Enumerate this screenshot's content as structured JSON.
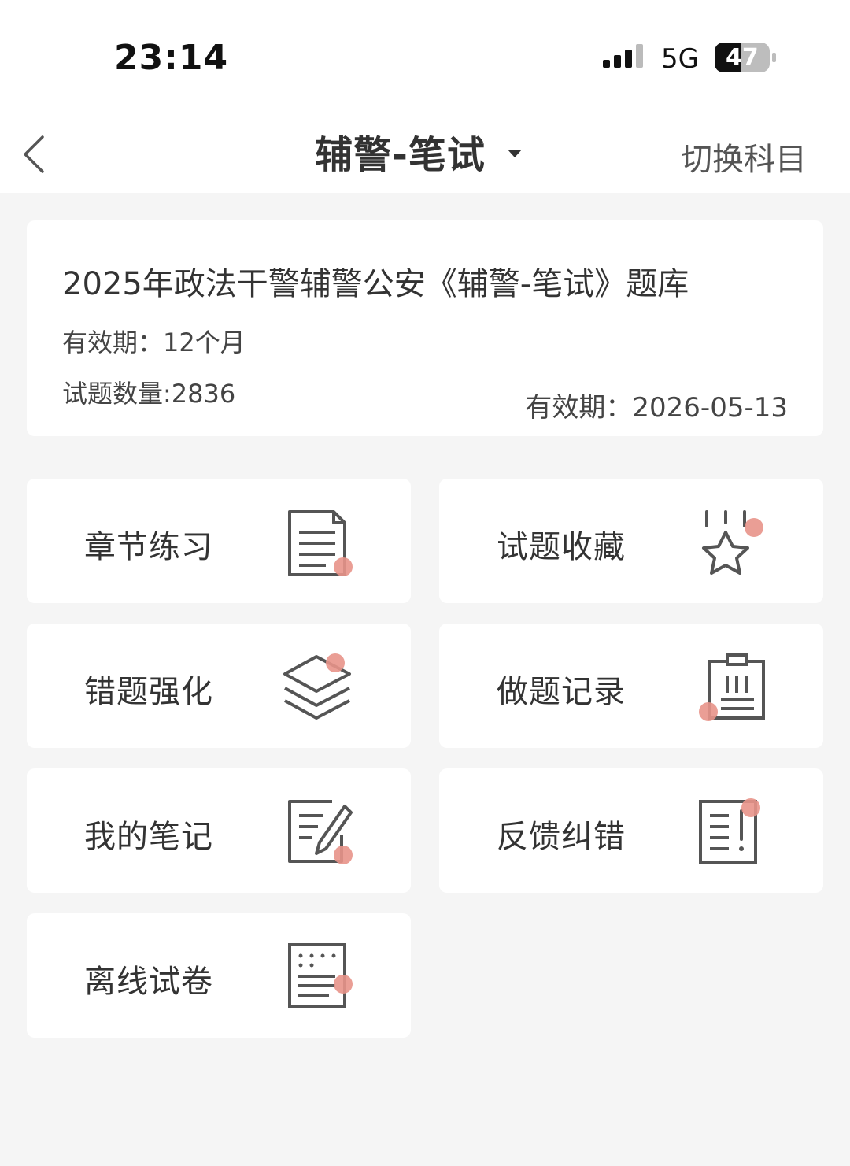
{
  "status_bar": {
    "time": "23:14",
    "network": "5G",
    "battery": "47"
  },
  "header": {
    "title": "辅警-笔试",
    "switch_label": "切换科目"
  },
  "info_card": {
    "title": "2025年政法干警辅警公安《辅警-笔试》题库",
    "validity": "有效期：12个月",
    "question_count": "试题数量:2836",
    "expiry": "有效期：2026-05-13"
  },
  "tiles": [
    {
      "label": "章节练习",
      "icon": "document-icon"
    },
    {
      "label": "试题收藏",
      "icon": "star-icon"
    },
    {
      "label": "错题强化",
      "icon": "layers-icon"
    },
    {
      "label": "做题记录",
      "icon": "clipboard-icon"
    },
    {
      "label": "我的笔记",
      "icon": "note-pencil-icon"
    },
    {
      "label": "反馈纠错",
      "icon": "feedback-icon"
    },
    {
      "label": "离线试卷",
      "icon": "offline-paper-icon"
    }
  ],
  "colors": {
    "accent_dot": "#e8948a",
    "icon_stroke": "#555555",
    "background": "#f5f5f5"
  }
}
